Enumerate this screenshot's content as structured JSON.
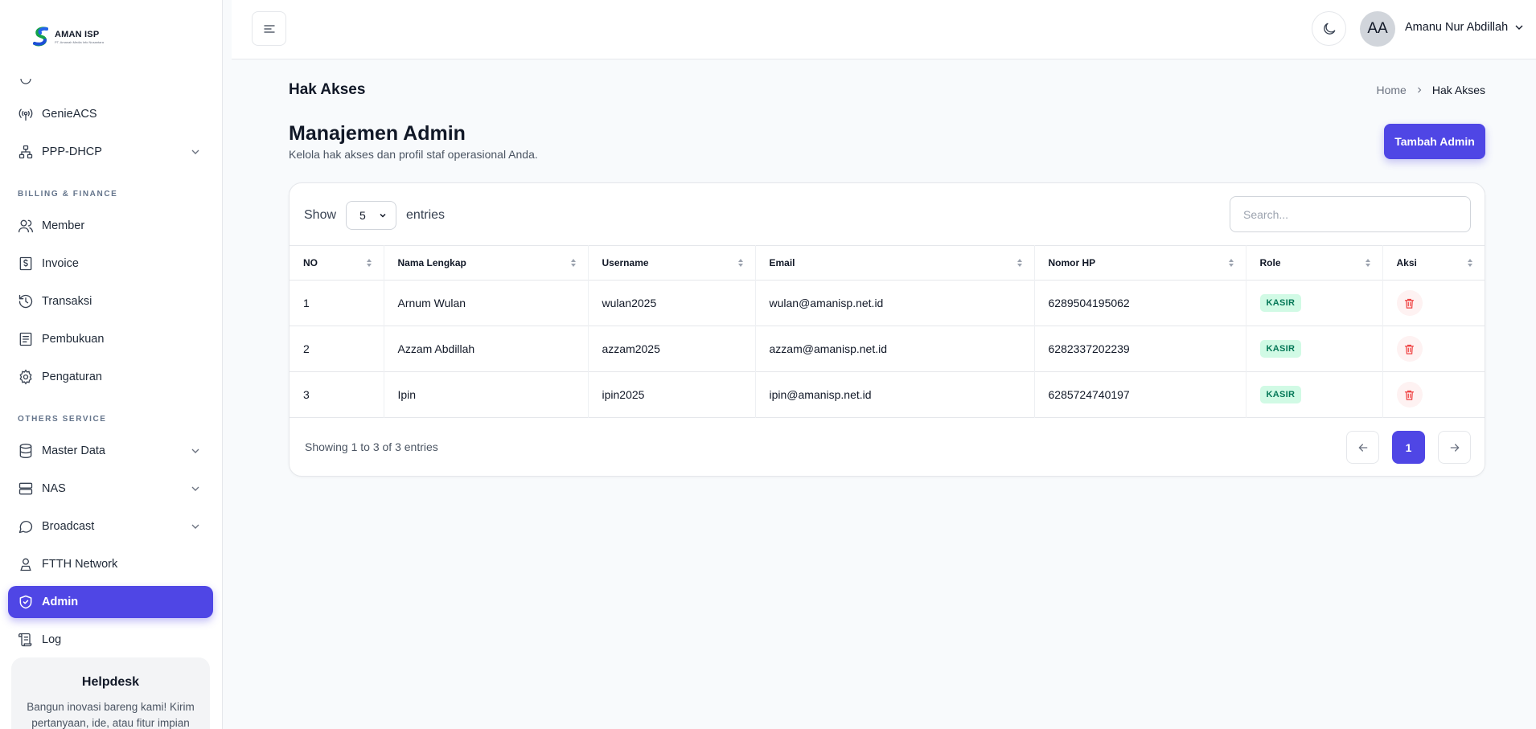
{
  "brand": {
    "name": "AMAN ISP",
    "tagline": "PT. Amanah Media Info Nusantara"
  },
  "sidebar": {
    "items": [
      {
        "label": "GenieACS",
        "icon": "antenna-icon"
      },
      {
        "label": "PPP-DHCP",
        "icon": "network-icon"
      },
      {
        "label": "Member",
        "icon": "users-icon"
      },
      {
        "label": "Invoice",
        "icon": "dollar-icon"
      },
      {
        "label": "Transaksi",
        "icon": "history-icon"
      },
      {
        "label": "Pembukuan",
        "icon": "ledger-icon"
      },
      {
        "label": "Pengaturan",
        "icon": "gear-icon"
      },
      {
        "label": "Master Data",
        "icon": "database-icon"
      },
      {
        "label": "NAS",
        "icon": "server-icon"
      },
      {
        "label": "Broadcast",
        "icon": "chat-icon"
      },
      {
        "label": "FTTH Network",
        "icon": "location-user-icon"
      },
      {
        "label": "Admin",
        "icon": "shield-icon"
      },
      {
        "label": "Log",
        "icon": "scroll-icon"
      }
    ],
    "sections": {
      "billing": "BILLING & FINANCE",
      "others": "OTHERS SERVICE"
    },
    "helpdesk": {
      "title": "Helpdesk",
      "text": "Bangun inovasi bareng kami! Kirim pertanyaan, ide, atau fitur impian"
    }
  },
  "topbar": {
    "avatar_initials": "AA",
    "user_name": "Amanu Nur Abdillah"
  },
  "page": {
    "title": "Hak Akses",
    "breadcrumb": {
      "home": "Home",
      "current": "Hak Akses"
    },
    "section_title": "Manajemen Admin",
    "section_subtitle": "Kelola hak akses dan profil staf operasional Anda.",
    "add_button": "Tambah Admin"
  },
  "table": {
    "show_label": "Show",
    "entries_label": "entries",
    "page_size": "5",
    "search_placeholder": "Search...",
    "columns": [
      "NO",
      "Nama Lengkap",
      "Username",
      "Email",
      "Nomor HP",
      "Role",
      "Aksi"
    ],
    "rows": [
      {
        "no": "1",
        "name": "Arnum Wulan",
        "username": "wulan2025",
        "email": "wulan@amanisp.net.id",
        "phone": "6289504195062",
        "role": "KASIR"
      },
      {
        "no": "2",
        "name": "Azzam Abdillah",
        "username": "azzam2025",
        "email": "azzam@amanisp.net.id",
        "phone": "6282337202239",
        "role": "KASIR"
      },
      {
        "no": "3",
        "name": "Ipin",
        "username": "ipin2025",
        "email": "ipin@amanisp.net.id",
        "phone": "6285724740197",
        "role": "KASIR"
      }
    ],
    "footer_info": "Showing 1 to 3 of 3 entries",
    "current_page": "1"
  },
  "colors": {
    "accent": "#4f46e5",
    "badge_bg": "#d1fae5",
    "badge_text": "#047857",
    "danger": "#ef4444"
  }
}
